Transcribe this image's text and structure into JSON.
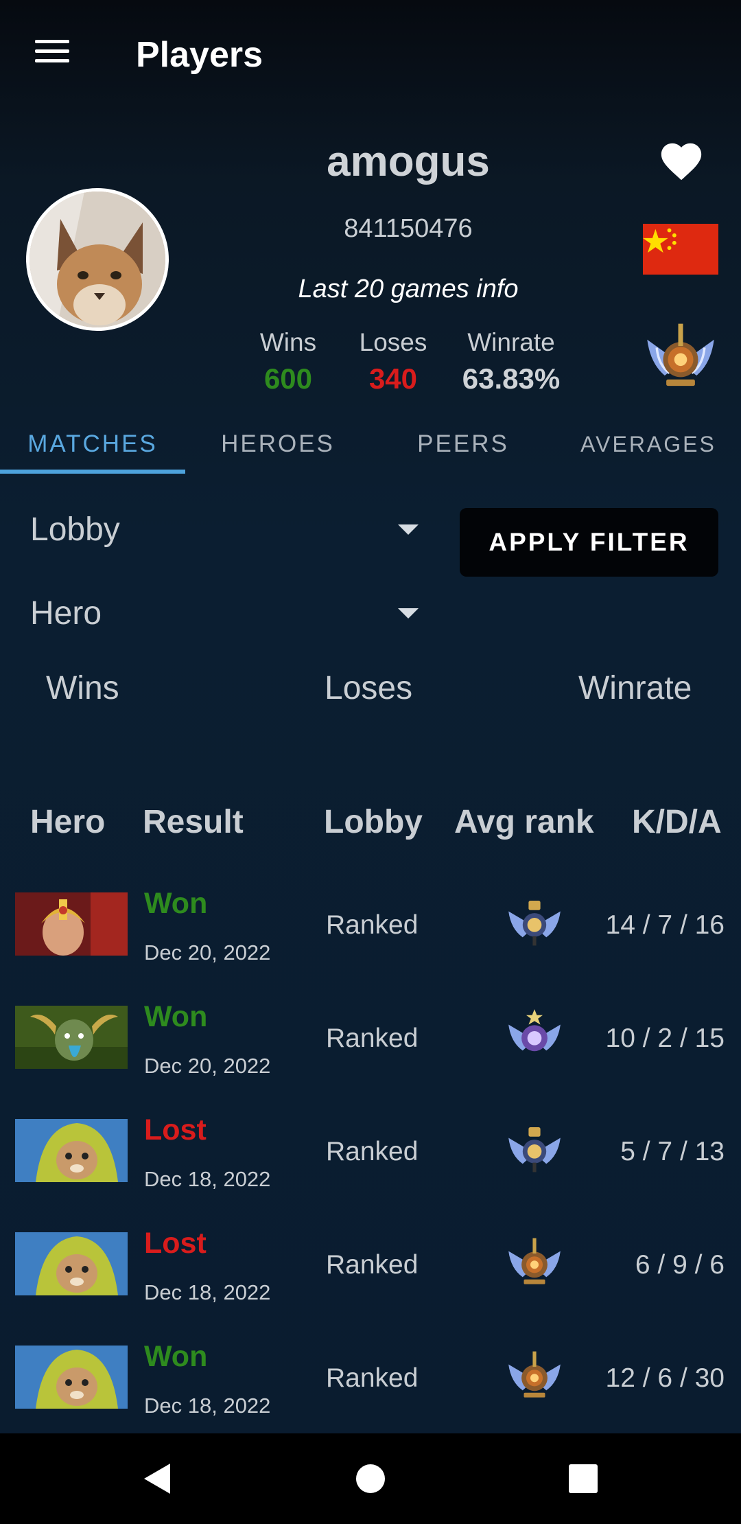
{
  "appbar": {
    "title": "Players"
  },
  "profile": {
    "name": "amogus",
    "id": "841150476",
    "subtitle": "Last 20 games info",
    "wins_label": "Wins",
    "wins": "600",
    "loses_label": "Loses",
    "loses": "340",
    "winrate_label": "Winrate",
    "winrate": "63.83%",
    "country_flag": "china-flag",
    "colors": {
      "wins": "#2e8b1e",
      "loses": "#d91c1c",
      "accent": "#4ea3dd"
    }
  },
  "tabs": [
    {
      "label": "MATCHES",
      "active": true
    },
    {
      "label": "HEROES",
      "active": false
    },
    {
      "label": "PEERS",
      "active": false
    },
    {
      "label": "AVERAGES",
      "active": false
    }
  ],
  "filters": {
    "lobby": "Lobby",
    "hero": "Hero",
    "apply_label": "APPLY FILTER"
  },
  "summary": {
    "wins": "Wins",
    "loses": "Loses",
    "winrate": "Winrate"
  },
  "table": {
    "headers": [
      "Hero",
      "Result",
      "Lobby",
      "Avg rank",
      "K/D/A"
    ],
    "rows": [
      {
        "hero": "hero-portrait-red-helmet",
        "result": "Won",
        "date": "Dec 20, 2022",
        "lobby": "Ranked",
        "rank": "rank-medal-silver",
        "kda": "14 / 7 / 16"
      },
      {
        "hero": "hero-portrait-green-horned",
        "result": "Won",
        "date": "Dec 20, 2022",
        "lobby": "Ranked",
        "rank": "rank-medal-purple",
        "kda": "10 / 2 / 15"
      },
      {
        "hero": "hero-portrait-hooded-rat",
        "result": "Lost",
        "date": "Dec 18, 2022",
        "lobby": "Ranked",
        "rank": "rank-medal-silver",
        "kda": "5 / 7 / 13"
      },
      {
        "hero": "hero-portrait-hooded-rat",
        "result": "Lost",
        "date": "Dec 18, 2022",
        "lobby": "Ranked",
        "rank": "rank-medal-bronze",
        "kda": "6 / 9 / 6"
      },
      {
        "hero": "hero-portrait-hooded-rat",
        "result": "Won",
        "date": "Dec 18, 2022",
        "lobby": "Ranked",
        "rank": "rank-medal-bronze",
        "kda": "12 / 6 / 30"
      }
    ]
  },
  "navbar": {
    "icons": [
      "back-icon",
      "home-icon",
      "recents-icon"
    ]
  }
}
